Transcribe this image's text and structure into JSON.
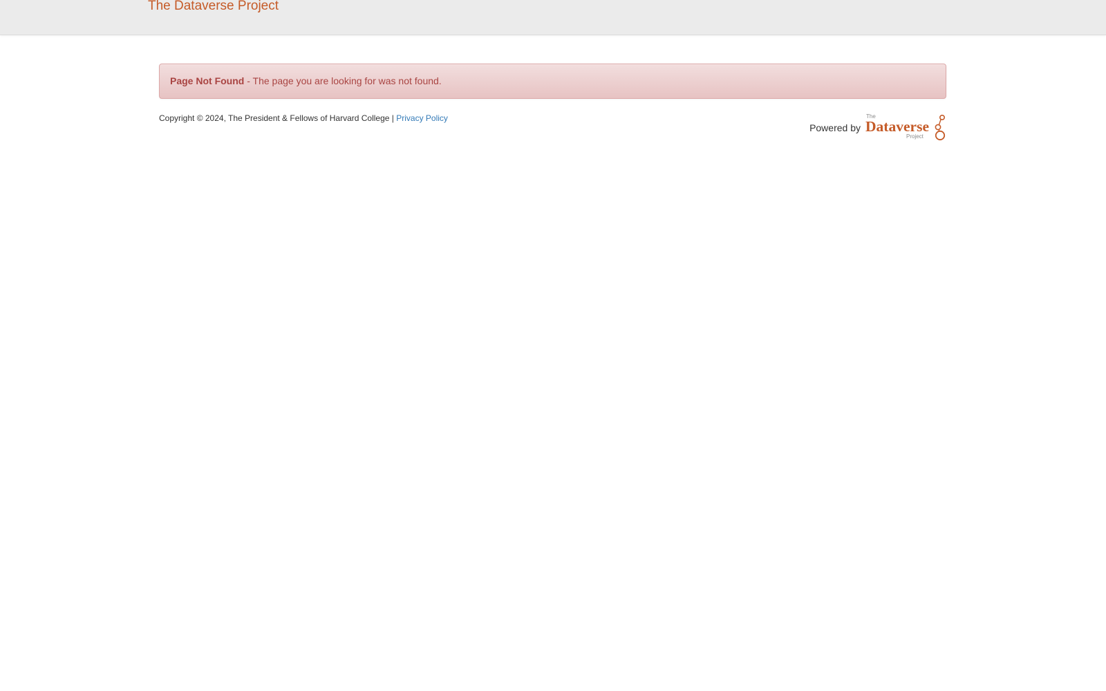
{
  "navbar": {
    "brand": "The Dataverse Project"
  },
  "alert": {
    "title": "Page Not Found",
    "message": " - The page you are looking for was not found."
  },
  "footer": {
    "copyright": "Copyright © 2024, The President & Fellows of Harvard College | ",
    "privacy_link": "Privacy Policy",
    "powered_by": "Powered by",
    "logo": {
      "small_top": "The",
      "name": "Dataverse",
      "small_bottom": "Project"
    }
  },
  "colors": {
    "brand": "#c55b28",
    "alert_text": "#a94442",
    "alert_bg": "#f2dede",
    "link": "#337ab7",
    "navbar_bg": "#ebebeb"
  }
}
